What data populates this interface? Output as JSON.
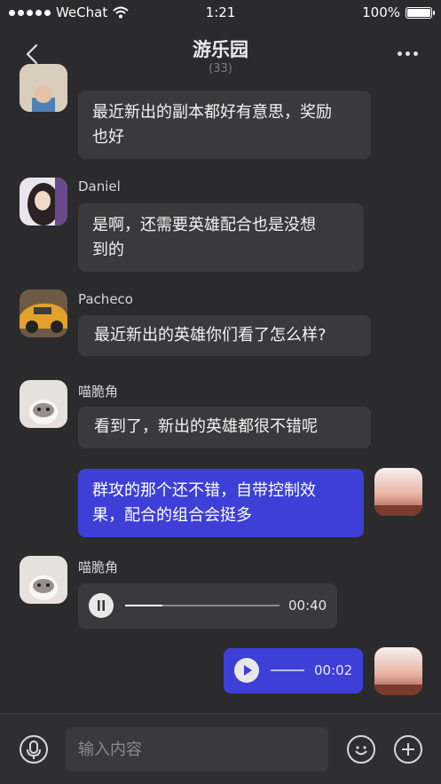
{
  "status_bar": {
    "carrier": "WeChat",
    "time": "1:21",
    "battery": "100%"
  },
  "nav": {
    "title": "游乐园",
    "member_count": "(33)",
    "back_icon": "chevron-left-icon",
    "more_icon": "more-dots-icon"
  },
  "messages": [
    {
      "sender": "",
      "mine": false,
      "text_lines": [
        "最近新出的副本都好有意思，奖励",
        "也好"
      ],
      "avatar": "avatar-boy"
    },
    {
      "sender": "Daniel",
      "mine": false,
      "text_lines": [
        "是啊，还需要英雄配合也是没想",
        "到的"
      ],
      "avatar": "avatar-girl"
    },
    {
      "sender": "Pacheco",
      "mine": false,
      "text_lines": [
        "最近新出的英雄你们看了怎么样?"
      ],
      "avatar": "avatar-car"
    },
    {
      "sender": "喵脆角",
      "mine": false,
      "text_lines": [
        "看到了，新出的英雄都很不错呢"
      ],
      "avatar": "avatar-cat"
    },
    {
      "sender": "",
      "mine": true,
      "text_lines": [
        "群攻的那个还不错，自带控制效",
        "果，配合的组合会挺多"
      ],
      "avatar": "avatar-sunset"
    },
    {
      "sender": "喵脆角",
      "mine": false,
      "type": "voice",
      "state": "paused",
      "progress": 0.24,
      "duration": "00:40",
      "avatar": "avatar-cat"
    },
    {
      "sender": "",
      "mine": true,
      "type": "voice",
      "state": "stopped",
      "duration": "00:02",
      "avatar": "avatar-sunset"
    }
  ],
  "input_bar": {
    "placeholder": "输入内容",
    "voice_icon": "microphone-icon",
    "emoji_icon": "smiley-icon",
    "add_icon": "plus-icon"
  },
  "colors": {
    "background": "#2b2b2d",
    "bubble_other": "#3a3a3c",
    "bubble_mine": "#3d3fd6"
  }
}
